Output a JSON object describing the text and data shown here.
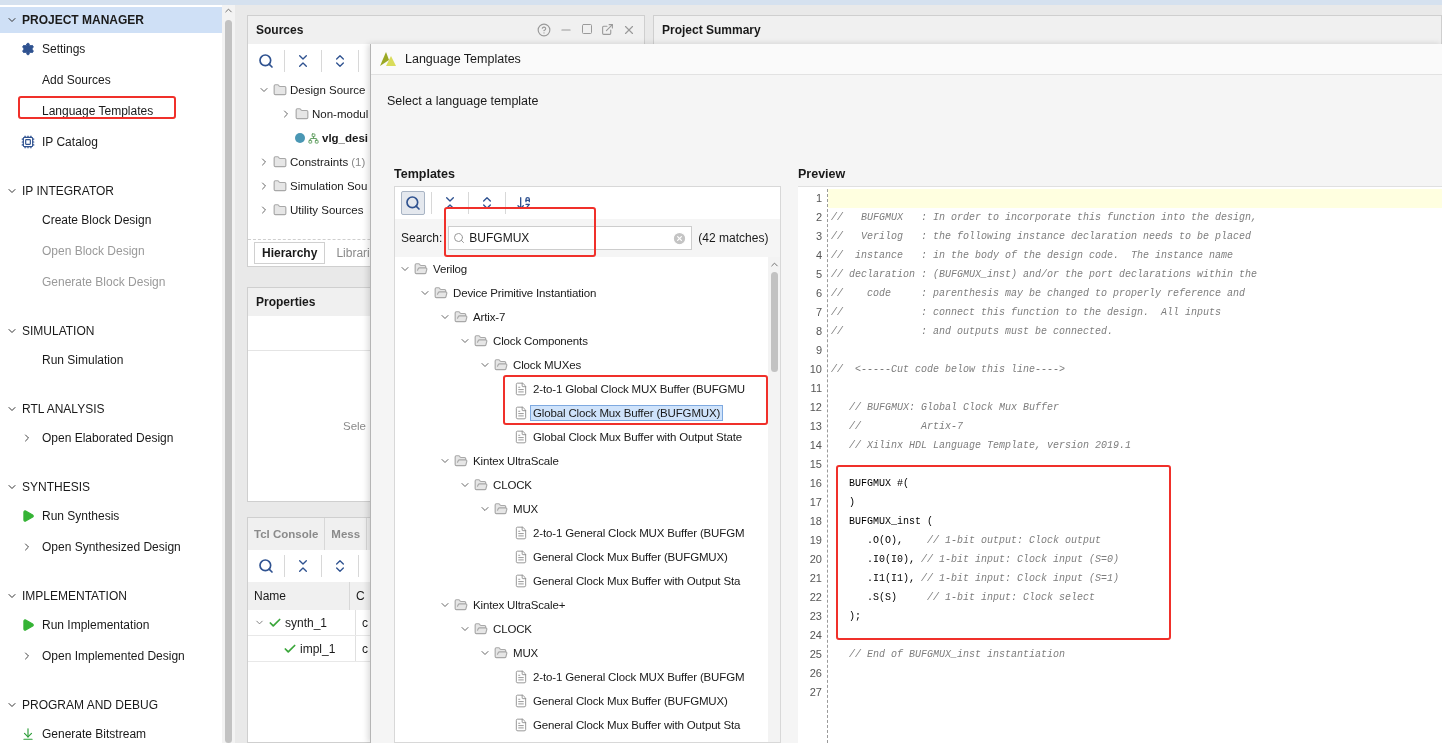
{
  "nav": {
    "sections": [
      {
        "title": "PROJECT MANAGER",
        "selected": true,
        "expanded": true,
        "items": [
          {
            "label": "Settings",
            "kind": "settings",
            "disabled": false,
            "annotated": false
          },
          {
            "label": "Add Sources",
            "kind": "plain",
            "disabled": false,
            "annotated": false
          },
          {
            "label": "Language Templates",
            "kind": "plain",
            "disabled": false,
            "annotated": true
          },
          {
            "label": "IP Catalog",
            "kind": "catalog",
            "disabled": false,
            "annotated": false
          }
        ]
      },
      {
        "title": "IP INTEGRATOR",
        "selected": false,
        "expanded": true,
        "items": [
          {
            "label": "Create Block Design",
            "kind": "plain",
            "disabled": false,
            "annotated": false
          },
          {
            "label": "Open Block Design",
            "kind": "plain",
            "disabled": true,
            "annotated": false
          },
          {
            "label": "Generate Block Design",
            "kind": "plain",
            "disabled": true,
            "annotated": false
          }
        ]
      },
      {
        "title": "SIMULATION",
        "selected": false,
        "expanded": true,
        "items": [
          {
            "label": "Run Simulation",
            "kind": "plain",
            "disabled": false,
            "annotated": false
          }
        ]
      },
      {
        "title": "RTL ANALYSIS",
        "selected": false,
        "expanded": true,
        "items": [
          {
            "label": "Open Elaborated Design",
            "kind": "open",
            "disabled": false,
            "annotated": false
          }
        ]
      },
      {
        "title": "SYNTHESIS",
        "selected": false,
        "expanded": true,
        "items": [
          {
            "label": "Run Synthesis",
            "kind": "run",
            "disabled": false,
            "annotated": false
          },
          {
            "label": "Open Synthesized Design",
            "kind": "open",
            "disabled": false,
            "annotated": false
          }
        ]
      },
      {
        "title": "IMPLEMENTATION",
        "selected": false,
        "expanded": true,
        "items": [
          {
            "label": "Run Implementation",
            "kind": "run",
            "disabled": false,
            "annotated": false
          },
          {
            "label": "Open Implemented Design",
            "kind": "open",
            "disabled": false,
            "annotated": false
          }
        ]
      },
      {
        "title": "PROGRAM AND DEBUG",
        "selected": false,
        "expanded": true,
        "items": [
          {
            "label": "Generate Bitstream",
            "kind": "bitstream",
            "disabled": false,
            "annotated": false
          }
        ]
      }
    ]
  },
  "sources": {
    "title": "Sources",
    "tree": [
      {
        "label": "Design Source",
        "kind": "folder",
        "expanded": true,
        "children": [
          {
            "label": "Non-modul",
            "kind": "folder",
            "expanded": false
          },
          {
            "label": "vlg_desi",
            "kind": "module"
          }
        ]
      },
      {
        "label": "Constraints",
        "count": "(1)",
        "kind": "folder",
        "expanded": false
      },
      {
        "label": "Simulation Sou",
        "kind": "folder",
        "expanded": false
      },
      {
        "label": "Utility Sources",
        "kind": "folder",
        "expanded": false
      }
    ],
    "tabs": [
      {
        "label": "Hierarchy",
        "selected": true
      },
      {
        "label": "Librari",
        "selected": false
      }
    ]
  },
  "properties": {
    "title": "Properties",
    "message": "Sele"
  },
  "console": {
    "tabs": [
      {
        "label": "Tcl Console"
      },
      {
        "label": "Mess"
      }
    ],
    "columns": [
      "Name",
      "C"
    ],
    "rows": [
      {
        "name": "synth_1",
        "column_2": "c",
        "expanded": true,
        "children": [
          {
            "name": "impl_1",
            "column_2": "c"
          }
        ]
      }
    ]
  },
  "summary": {
    "title": "Project Summary"
  },
  "dialog": {
    "title": "Language Templates",
    "prompt": "Select a language template",
    "templates": {
      "title": "Templates",
      "search_active": true,
      "search_label": "Search:",
      "search_value": "BUFGMUX",
      "search_annotated": true,
      "match_count": "(42 matches)",
      "tree": [
        {
          "label": "Verilog",
          "kind": "folder",
          "expanded": true,
          "children": [
            {
              "label": "Device Primitive Instantiation",
              "kind": "folder",
              "expanded": true,
              "children": [
                {
                  "label": "Artix-7",
                  "kind": "folder",
                  "expanded": true,
                  "children": [
                    {
                      "label": "Clock Components",
                      "kind": "folder",
                      "expanded": true,
                      "children": [
                        {
                          "label": "Clock MUXes",
                          "kind": "folder",
                          "expanded": true,
                          "children": [
                            {
                              "label": "2-to-1 Global Clock MUX Buffer (BUFGMU",
                              "kind": "template",
                              "selected": false,
                              "annotated": true
                            },
                            {
                              "label": "Global Clock Mux Buffer (BUFGMUX)",
                              "kind": "template",
                              "selected": true,
                              "annotated": true
                            },
                            {
                              "label": "Global Clock Mux Buffer with Output State",
                              "kind": "template",
                              "selected": false,
                              "annotated": false
                            }
                          ]
                        }
                      ]
                    }
                  ]
                },
                {
                  "label": "Kintex UltraScale",
                  "kind": "folder",
                  "expanded": true,
                  "children": [
                    {
                      "label": "CLOCK",
                      "kind": "folder",
                      "expanded": true,
                      "children": [
                        {
                          "label": "MUX",
                          "kind": "folder",
                          "expanded": true,
                          "children": [
                            {
                              "label": "2-to-1 General Clock MUX Buffer (BUFGM",
                              "kind": "template",
                              "selected": false,
                              "annotated": false
                            },
                            {
                              "label": "General Clock Mux Buffer (BUFGMUX)",
                              "kind": "template",
                              "selected": false,
                              "annotated": false
                            },
                            {
                              "label": "General Clock Mux Buffer with Output Sta",
                              "kind": "template",
                              "selected": false,
                              "annotated": false
                            }
                          ]
                        }
                      ]
                    }
                  ]
                },
                {
                  "label": "Kintex UltraScale+",
                  "kind": "folder",
                  "expanded": true,
                  "children": [
                    {
                      "label": "CLOCK",
                      "kind": "folder",
                      "expanded": true,
                      "children": [
                        {
                          "label": "MUX",
                          "kind": "folder",
                          "expanded": true,
                          "children": [
                            {
                              "label": "2-to-1 General Clock MUX Buffer (BUFGM",
                              "kind": "template",
                              "selected": false,
                              "annotated": false
                            },
                            {
                              "label": "General Clock Mux Buffer (BUFGMUX)",
                              "kind": "template",
                              "selected": false,
                              "annotated": false
                            },
                            {
                              "label": "General Clock Mux Buffer with Output Sta",
                              "kind": "template",
                              "selected": false,
                              "annotated": false
                            }
                          ]
                        }
                      ]
                    }
                  ]
                }
              ]
            }
          ]
        }
      ]
    },
    "preview": {
      "title": "Preview",
      "lines": [
        {
          "n": "1",
          "current": true,
          "annotated": false
        },
        {
          "n": "2",
          "comment": "//   BUFGMUX   : In order to incorporate this function into the design,",
          "current": false,
          "annotated": false
        },
        {
          "n": "3",
          "comment": "//   Verilog   : the following instance declaration needs to be placed",
          "current": false,
          "annotated": false
        },
        {
          "n": "4",
          "comment": "//  instance   : in the body of the design code.  The instance name",
          "current": false,
          "annotated": false
        },
        {
          "n": "5",
          "comment": "// declaration : (BUFGMUX_inst) and/or the port declarations within the",
          "current": false,
          "annotated": false
        },
        {
          "n": "6",
          "comment": "//    code     : parenthesis may be changed to properly reference and",
          "current": false,
          "annotated": false
        },
        {
          "n": "7",
          "comment": "//             : connect this function to the design.  All inputs",
          "current": false,
          "annotated": false
        },
        {
          "n": "8",
          "comment": "//             : and outputs must be connected.",
          "current": false,
          "annotated": false
        },
        {
          "n": "9",
          "current": false,
          "annotated": false
        },
        {
          "n": "10",
          "comment": "//  <-----Cut code below this line---->",
          "current": false,
          "annotated": false
        },
        {
          "n": "11",
          "current": false,
          "annotated": false
        },
        {
          "n": "12",
          "comment": "   // BUFGMUX: Global Clock Mux Buffer",
          "current": false,
          "annotated": false
        },
        {
          "n": "13",
          "comment": "   //          Artix-7",
          "current": false,
          "annotated": false
        },
        {
          "n": "14",
          "comment": "   // Xilinx HDL Language Template, version 2019.1",
          "current": false,
          "annotated": false
        },
        {
          "n": "15",
          "current": false,
          "annotated": false
        },
        {
          "n": "16",
          "code": "   BUFGMUX #(",
          "current": false,
          "annotated": true
        },
        {
          "n": "17",
          "code": "   )",
          "current": false,
          "annotated": true
        },
        {
          "n": "18",
          "code": "   BUFGMUX_inst (",
          "current": false,
          "annotated": true
        },
        {
          "n": "19",
          "code": "      .O(O),",
          "comment": "    // 1-bit output: Clock output",
          "current": false,
          "annotated": true
        },
        {
          "n": "20",
          "code": "      .I0(I0),",
          "comment": " // 1-bit input: Clock input (S=0)",
          "current": false,
          "annotated": true
        },
        {
          "n": "21",
          "code": "      .I1(I1),",
          "comment": " // 1-bit input: Clock input (S=1)",
          "current": false,
          "annotated": true
        },
        {
          "n": "22",
          "code": "      .S(S)",
          "comment": "     // 1-bit input: Clock select",
          "current": false,
          "annotated": true
        },
        {
          "n": "23",
          "code": "   );",
          "current": false,
          "annotated": true
        },
        {
          "n": "24",
          "current": false,
          "annotated": false
        },
        {
          "n": "25",
          "comment": "   // End of BUFGMUX_inst instantiation",
          "current": false,
          "annotated": false
        },
        {
          "n": "26",
          "current": false,
          "annotated": false
        },
        {
          "n": "27",
          "current": false,
          "annotated": false
        }
      ]
    }
  }
}
